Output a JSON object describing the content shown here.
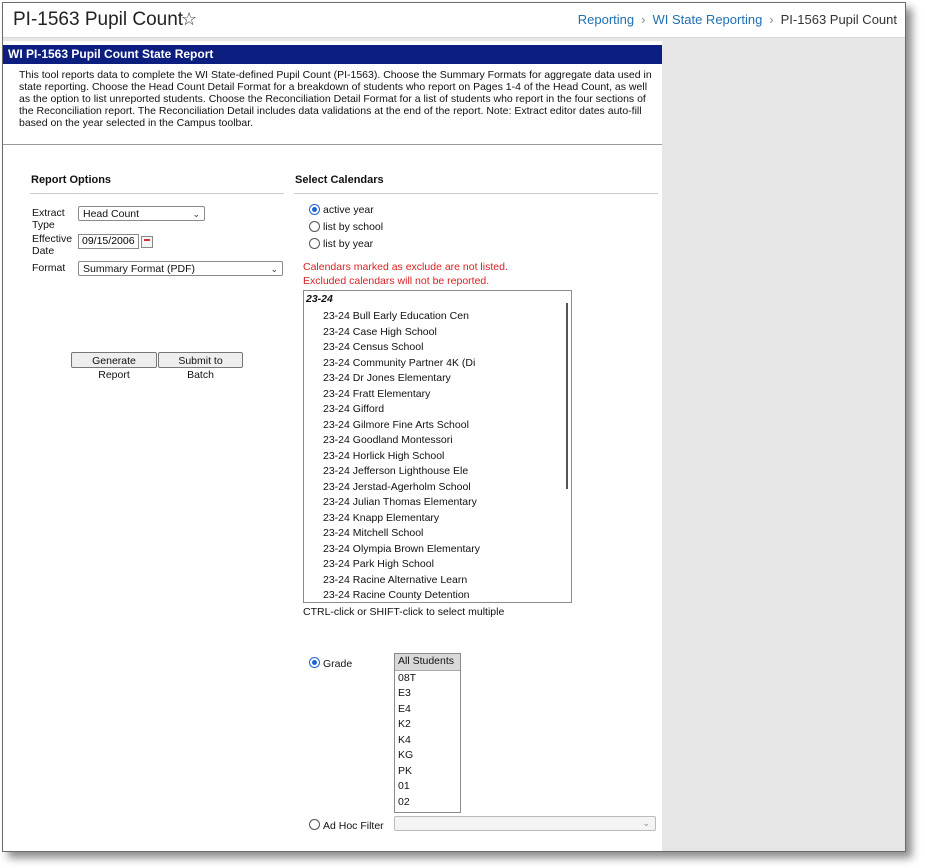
{
  "title": "PI-1563 Pupil Count",
  "breadcrumb": [
    "Reporting",
    "WI State Reporting",
    "PI-1563 Pupil Count"
  ],
  "header": "WI PI-1563 Pupil Count State Report",
  "description": "This tool reports data to complete the WI State-defined Pupil Count (PI-1563). Choose the Summary Formats for aggregate data used in state reporting. Choose the Head Count Detail Format for a breakdown of students who report on Pages 1-4 of the Head Count, as well as the option to list unreported students. Choose the Reconciliation Detail Format for a list of students who report in the four sections of the Reconciliation report. The Reconciliation Detail includes data validations at the end of the report. Note: Extract editor dates auto-fill based on the year selected in the Campus toolbar.",
  "report_options": {
    "heading": "Report Options",
    "extract_type_label_1": "Extract",
    "extract_type_label_2": "Type",
    "extract_type_value": "Head Count",
    "effective_date_label_1": "Effective",
    "effective_date_label_2": "Date",
    "effective_date_value": "09/15/2006",
    "format_label": "Format",
    "format_value": "Summary Format (PDF)",
    "generate_button": "Generate Report",
    "batch_button": "Submit to Batch"
  },
  "calendars": {
    "heading": "Select Calendars",
    "options": [
      "active year",
      "list by school",
      "list by year"
    ],
    "selected_option": "active year",
    "warning_1": "Calendars marked as exclude are not listed.",
    "warning_2": "Excluded calendars will not be reported.",
    "group": "23-24",
    "items": [
      "23-24 Bull Early Education Cen",
      "23-24 Case High School",
      "23-24 Census School",
      "23-24 Community Partner 4K (Di",
      "23-24 Dr Jones Elementary",
      "23-24 Fratt Elementary",
      "23-24 Gifford",
      "23-24 Gilmore Fine Arts School",
      "23-24 Goodland Montessori",
      "23-24 Horlick High School",
      "23-24 Jefferson Lighthouse Ele",
      "23-24 Jerstad-Agerholm School",
      "23-24 Julian Thomas Elementary",
      "23-24 Knapp Elementary",
      "23-24 Mitchell School",
      "23-24 Olympia Brown Elementary",
      "23-24 Park High School",
      "23-24 Racine Alternative Learn",
      "23-24 Racine County Detention"
    ],
    "hint": "CTRL-click or SHIFT-click to select multiple"
  },
  "filter": {
    "grade_label": "Grade",
    "grade_selected": true,
    "grades": [
      "All Students",
      "08T",
      "E3",
      "E4",
      "K2",
      "K4",
      "KG",
      "PK",
      "01",
      "02"
    ],
    "adhoc_label": "Ad Hoc Filter",
    "adhoc_value": ""
  },
  "colors": {
    "header_bg": "#0c1e80",
    "link": "#1f6fb5",
    "warning": "#d82020",
    "radio_accent": "#1e63d6"
  },
  "icons": {
    "favorite": "star-icon",
    "calendar": "calendar-icon",
    "dropdown": "chevron-down-icon",
    "breadcrumb_separator": "chevron-right-icon"
  }
}
